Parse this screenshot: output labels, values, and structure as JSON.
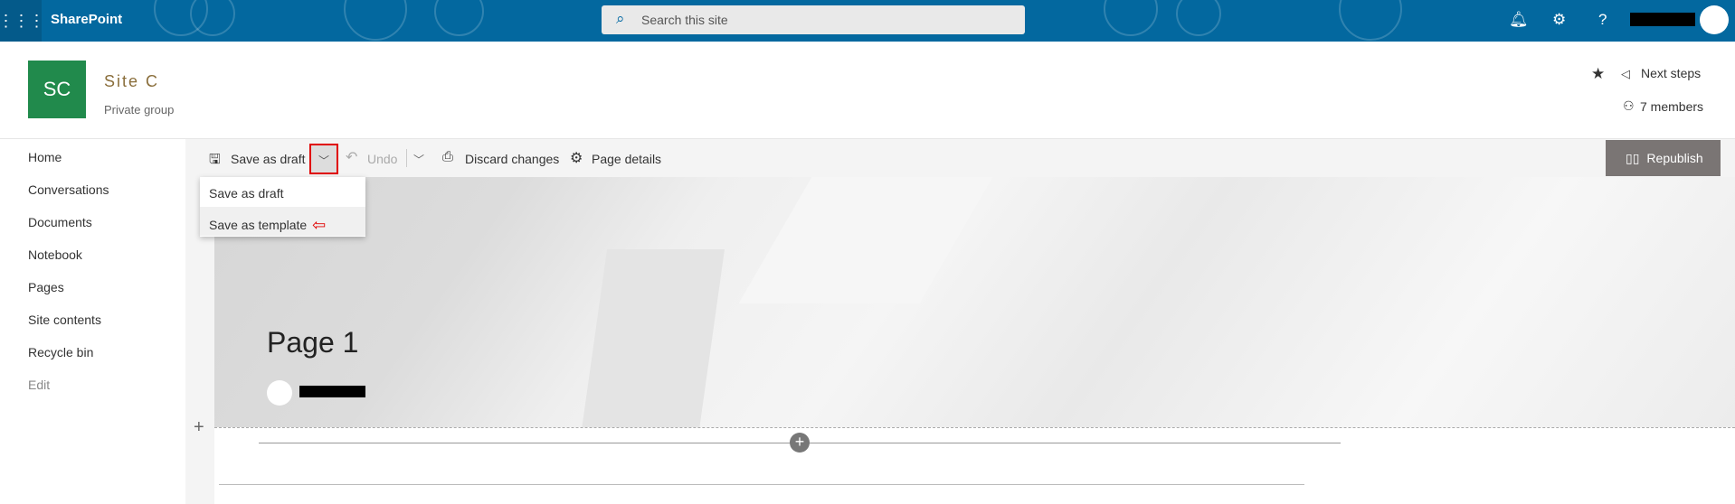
{
  "topbar": {
    "app_name": "SharePoint",
    "search_placeholder": "Search this site",
    "icons": [
      "waffle-icon",
      "bell-icon",
      "gear-icon",
      "help-icon"
    ]
  },
  "site": {
    "logo_initials": "SC",
    "logo_color": "#218a4c",
    "name": "Site C",
    "privacy": "Private group",
    "next_steps": "Next steps",
    "members": "7 members"
  },
  "toolbar": {
    "save_draft": "Save as draft",
    "undo": "Undo",
    "discard": "Discard changes",
    "page_details": "Page details",
    "republish": "Republish"
  },
  "save_menu": {
    "items": [
      "Save as draft",
      "Save as template"
    ],
    "highlighted": "Save as template"
  },
  "sidebar": {
    "items": [
      "Home",
      "Conversations",
      "Documents",
      "Notebook",
      "Pages",
      "Site contents",
      "Recycle bin",
      "Edit"
    ]
  },
  "page": {
    "title": "Page 1"
  },
  "colors": {
    "topbar": "#03689f",
    "republish": "#7a7574",
    "annotation": "#e00000"
  }
}
